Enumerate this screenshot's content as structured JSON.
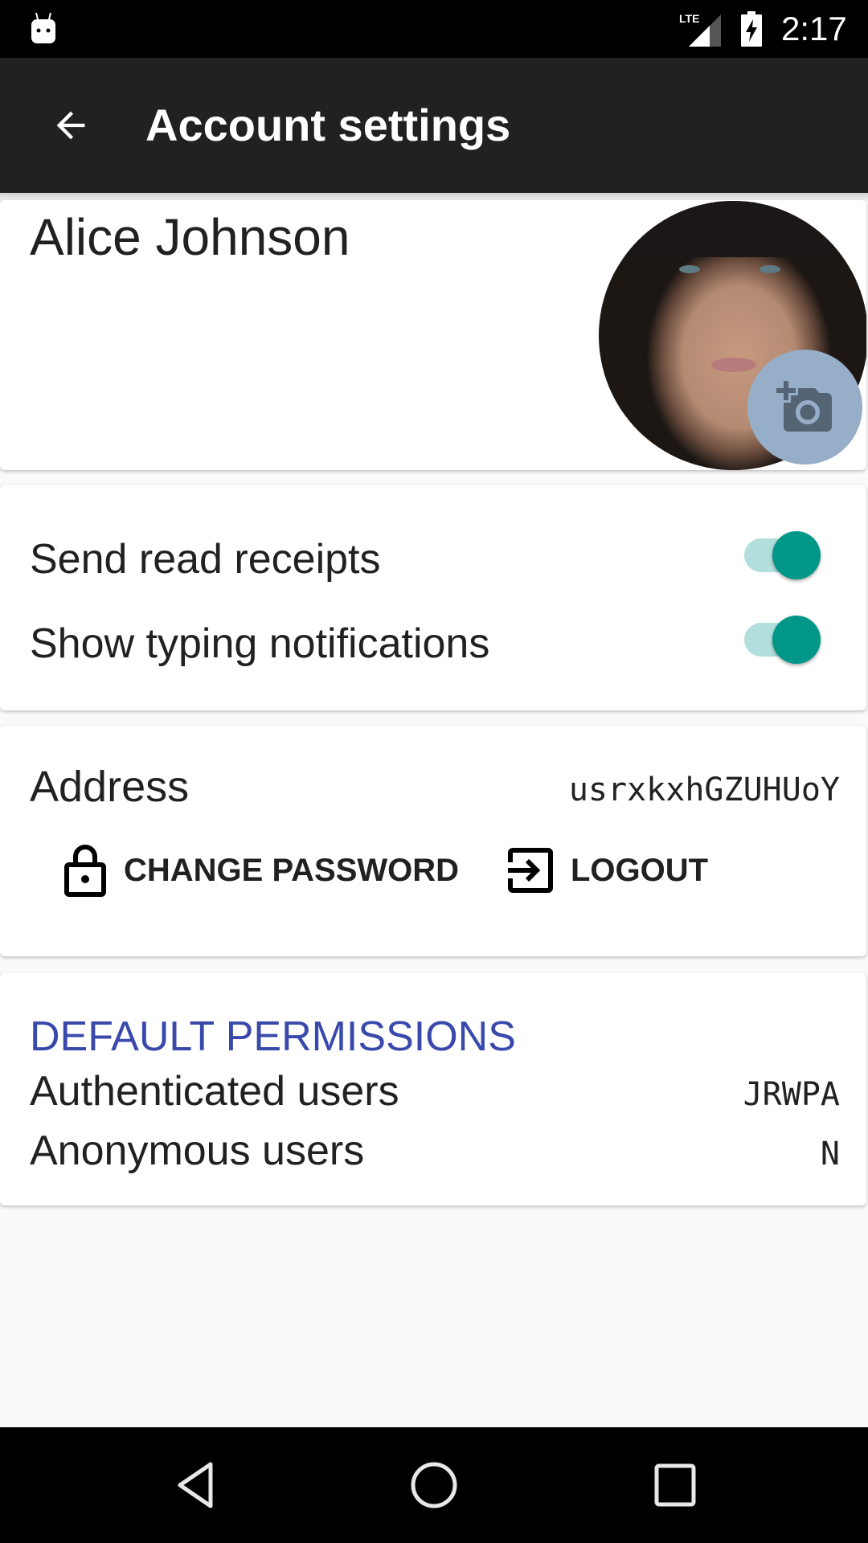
{
  "status_bar": {
    "time": "2:17",
    "network": "LTE",
    "icons": [
      "android-notification-icon",
      "lte-signal-icon",
      "battery-charging-icon"
    ]
  },
  "toolbar": {
    "back_icon": "arrow-back-icon",
    "title": "Account settings"
  },
  "profile": {
    "name": "Alice Johnson",
    "avatar": "user-photo",
    "change_photo_icon": "add-a-photo-icon"
  },
  "settings": {
    "toggles": [
      {
        "label": "Send read receipts",
        "on": true
      },
      {
        "label": "Show typing notifications",
        "on": true
      }
    ]
  },
  "account": {
    "address_label": "Address",
    "address_value": "usrxkxhGZUHUoY",
    "change_password_label": "CHANGE PASSWORD",
    "logout_label": "LOGOUT"
  },
  "permissions": {
    "title": "DEFAULT PERMISSIONS",
    "rows": [
      {
        "label": "Authenticated users",
        "value": "JRWPA"
      },
      {
        "label": "Anonymous users",
        "value": "N"
      }
    ]
  },
  "colors": {
    "toolbar": "#212121",
    "accent_teal": "#009688",
    "track_teal": "#b2dfdb",
    "section_title": "#3949ab",
    "camera_button": "#97aec8"
  },
  "nav_bar": {
    "buttons": [
      "back",
      "home",
      "recents"
    ]
  }
}
